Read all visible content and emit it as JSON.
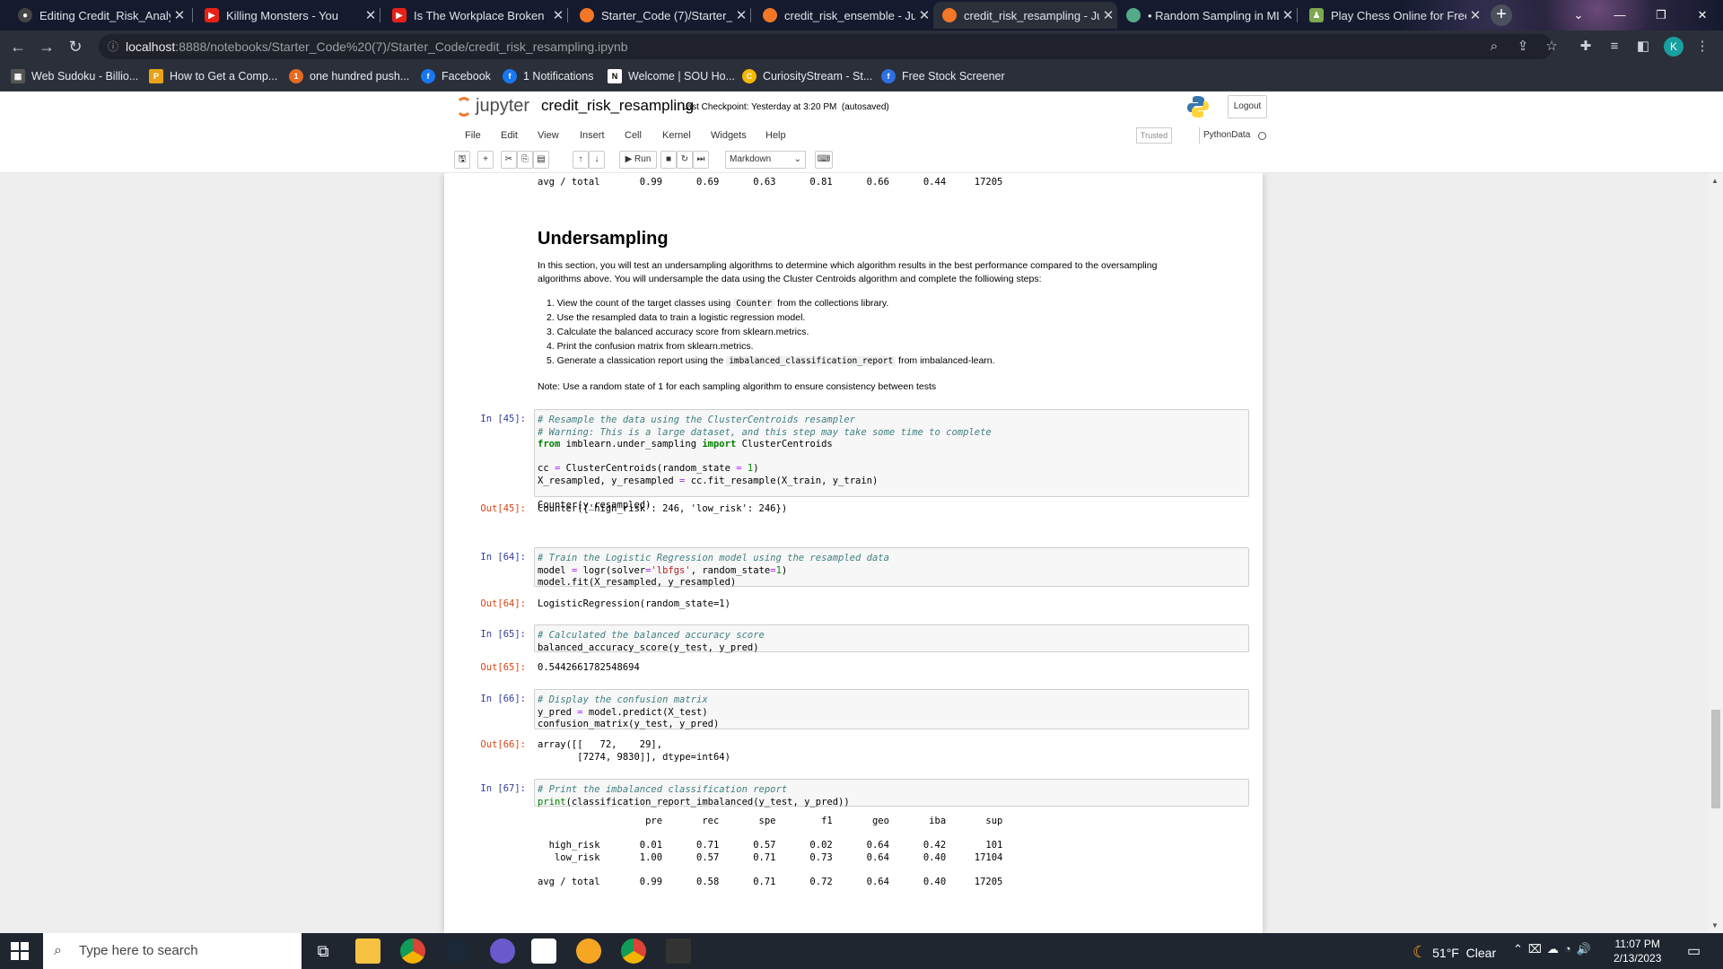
{
  "browser": {
    "tabs": [
      "Editing Credit_Risk_Analys",
      "Killing Monsters - You",
      "Is The Workplace Broken",
      "Starter_Code (7)/Starter_C",
      "credit_risk_ensemble - Jup",
      "credit_risk_resampling - Ju",
      "• Random Sampling in ML:",
      "Play Chess Online for Free"
    ],
    "url_host": "localhost",
    "url_path": ":8888/notebooks/Starter_Code%20(7)/Starter_Code/credit_risk_resampling.ipynb",
    "bookmarks": [
      "Web Sudoku - Billio...",
      "How to Get a Comp...",
      "one hundred push...",
      "Facebook",
      "1 Notifications",
      "Welcome | SOU Ho...",
      "CuriosityStream - St...",
      "Free Stock Screener"
    ],
    "profile": "K"
  },
  "jupyter": {
    "logo": "jupyter",
    "notebook_name": "credit_risk_resampling",
    "checkpoint": "Last Checkpoint: Yesterday at 3:20 PM",
    "autosaved": "(autosaved)",
    "logout": "Logout",
    "menu": [
      "File",
      "Edit",
      "View",
      "Insert",
      "Cell",
      "Kernel",
      "Widgets",
      "Help"
    ],
    "trusted": "Trusted",
    "kernel": "PythonData",
    "run": "Run",
    "cell_type": "Markdown"
  },
  "notebook": {
    "prev_avg": "avg / total       0.99      0.69      0.63      0.81      0.66      0.44     17205",
    "heading": "Undersampling",
    "intro1": "In this section, you will test an undersampling algorithms to determine which algorithm results in the best performance compared to the oversampling",
    "intro2": "algorithms above. You will undersample the data using the Cluster Centroids algorithm and complete the folliowing steps:",
    "steps": [
      "1. View the count of the target classes using",
      "2. Use the resampled data to train a logistic regression model.",
      "3. Calculate the balanced accuracy score from sklearn.metrics.",
      "4. Print the confusion matrix from sklearn.metrics.",
      "5. Generate a classication report using the"
    ],
    "step1_code": "Counter",
    "step1_tail": "from the collections library.",
    "step5_code": "imbalanced_classification_report",
    "step5_tail": "from imbalanced-learn.",
    "note": "Note: Use a random state of 1 for each sampling algorithm to ensure consistency between tests",
    "cells": [
      {
        "in": "In [45]:",
        "out": "Out[45]:",
        "output": "Counter({'high_risk': 246, 'low_risk': 246})"
      },
      {
        "in": "In [64]:",
        "out": "Out[64]:",
        "output": "LogisticRegression(random_state=1)"
      },
      {
        "in": "In [65]:",
        "out": "Out[65]:",
        "output": "0.5442661782548694"
      },
      {
        "in": "In [66]:",
        "out": "Out[66]:",
        "output": "array([[   72,    29],\n       [7274, 9830]], dtype=int64)"
      },
      {
        "in": "In [67]:"
      }
    ],
    "report": "                   pre       rec       spe        f1       geo       iba       sup\n\n  high_risk       0.01      0.71      0.57      0.02      0.64      0.42       101\n   low_risk       1.00      0.57      0.71      0.73      0.64      0.40     17104\n\navg / total       0.99      0.58      0.71      0.72      0.64      0.40     17205"
  },
  "taskbar": {
    "search": "Type here to search",
    "temp": "51°F",
    "weather": "Clear",
    "time": "11:07 PM",
    "date": "2/13/2023"
  }
}
